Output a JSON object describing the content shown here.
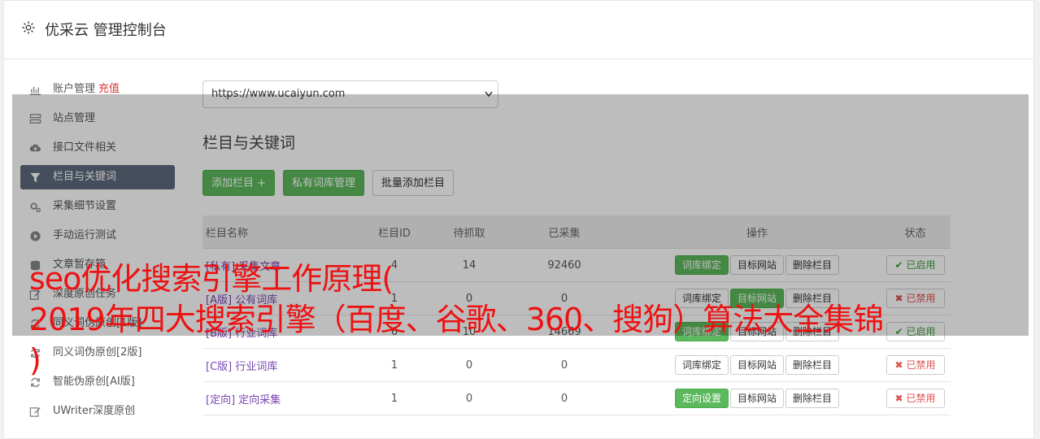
{
  "app": {
    "title": "优采云 管理控制台"
  },
  "sidebar": {
    "items": [
      {
        "label": "账户管理",
        "extra": "充值",
        "icon": "bar-chart-icon"
      },
      {
        "label": "站点管理",
        "extra": "",
        "icon": "server-icon"
      },
      {
        "label": "接口文件相关",
        "extra": "",
        "icon": "cloud-upload-icon"
      },
      {
        "label": "栏目与关键词",
        "extra": "",
        "icon": "filter-icon",
        "active": true
      },
      {
        "label": "采集细节设置",
        "extra": "",
        "icon": "cogs-icon"
      },
      {
        "label": "手动运行测试",
        "extra": "",
        "icon": "play-circle-icon"
      },
      {
        "label": "文章暂存箱",
        "extra": "",
        "icon": "database-icon"
      },
      {
        "label": "深度原创任务",
        "extra": "",
        "icon": "edit-icon"
      },
      {
        "label": "同义词伪原创[1版]",
        "extra": "",
        "icon": "refresh-icon"
      },
      {
        "label": "同义词伪原创[2版]",
        "extra": "",
        "icon": "refresh-icon"
      },
      {
        "label": "智能伪原创[AI版]",
        "extra": "",
        "icon": "refresh-icon"
      },
      {
        "label": "UWriter深度原创",
        "extra": "",
        "icon": "edit-icon"
      }
    ]
  },
  "main": {
    "site_select": "https://www.ucaiyun.com",
    "section_title": "栏目与关键词",
    "buttons": {
      "add": "添加栏目 +",
      "private_lib": "私有词库管理",
      "batch_add": "批量添加栏目"
    },
    "table": {
      "headers": [
        "栏目名称",
        "栏目ID",
        "待抓取",
        "已采集",
        "操作",
        "状态"
      ],
      "rows": [
        {
          "tag": "[私有]",
          "name": "采集文章",
          "id": "4",
          "pending": "14",
          "collected": "92460",
          "btn1": "词库绑定",
          "btn1_green": true,
          "btn2": "目标网站",
          "btn2_green": false,
          "btn3": "删除栏目",
          "status": "已启用",
          "status_on": true
        },
        {
          "tag": "[A版]",
          "name": "公有词库",
          "id": "1",
          "pending": "0",
          "collected": "0",
          "btn1": "词库绑定",
          "btn1_green": false,
          "btn2": "目标网站",
          "btn2_green": true,
          "btn3": "删除栏目",
          "status": "已禁用",
          "status_on": false
        },
        {
          "tag": "[B版]",
          "name": "行业词库",
          "id": "6",
          "pending": "10",
          "collected": "14669",
          "btn1": "词库绑定",
          "btn1_green": true,
          "btn2": "目标网站",
          "btn2_green": false,
          "btn3": "删除栏目",
          "status": "已启用",
          "status_on": true
        },
        {
          "tag": "[C版]",
          "name": "行业词库",
          "id": "1",
          "pending": "0",
          "collected": "0",
          "btn1": "词库绑定",
          "btn1_green": false,
          "btn2": "目标网站",
          "btn2_green": false,
          "btn3": "删除栏目",
          "status": "已禁用",
          "status_on": false
        },
        {
          "tag": "[定向]",
          "name": "定向采集",
          "id": "1",
          "pending": "0",
          "collected": "0",
          "btn1": "定向设置",
          "btn1_green": true,
          "btn2": "目标网站",
          "btn2_green": false,
          "btn3": "删除栏目",
          "status": "已禁用",
          "status_on": false
        }
      ]
    }
  },
  "overlay_title": {
    "line1": "seo优化搜索引擎工作原理(",
    "line2": "2019年四大搜索引擎（百度、谷歌、360、搜狗）算法大全集锦",
    "line3": ")"
  },
  "colors": {
    "green": "#5cb85c",
    "active_nav": "#5d6a7c",
    "overlay_text": "#ee1111",
    "tag": "#7a44b3"
  }
}
